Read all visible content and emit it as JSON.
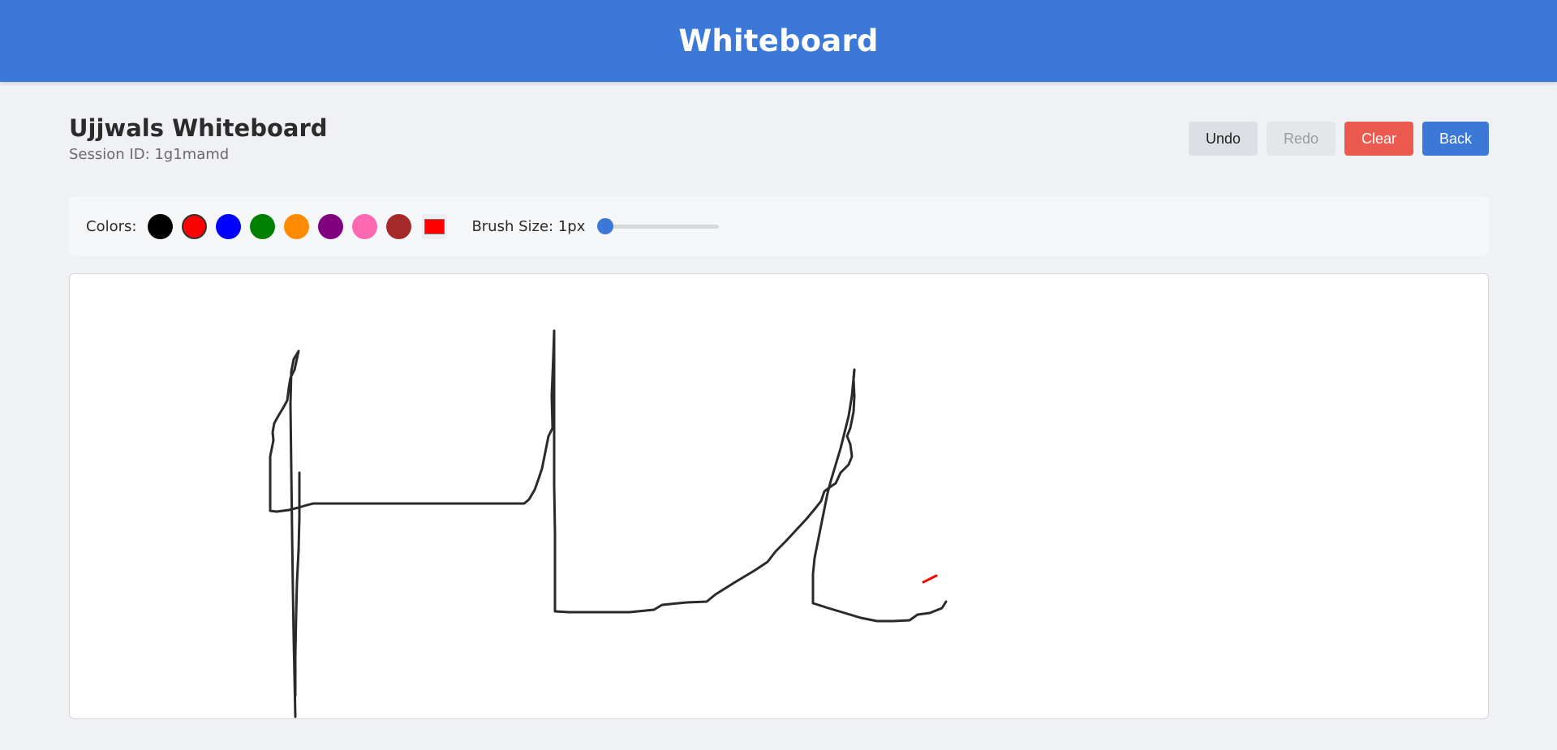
{
  "header": {
    "title": "Whiteboard"
  },
  "board": {
    "name": "Ujjwals Whiteboard",
    "session_text": "Session ID: 1g1mamd"
  },
  "actions": {
    "undo_label": "Undo",
    "redo_label": "Redo",
    "clear_label": "Clear",
    "back_label": "Back"
  },
  "toolbar": {
    "colors_label": "Colors:",
    "palette": [
      {
        "name": "black",
        "hex": "#000000"
      },
      {
        "name": "red",
        "hex": "#ff0000"
      },
      {
        "name": "blue",
        "hex": "#0000ff"
      },
      {
        "name": "green",
        "hex": "#008000"
      },
      {
        "name": "orange",
        "hex": "#ff8c00"
      },
      {
        "name": "purple",
        "hex": "#800080"
      },
      {
        "name": "pink",
        "hex": "#ff69b4"
      },
      {
        "name": "brown",
        "hex": "#a52a2a"
      }
    ],
    "selected_color": "#ff0000",
    "brush_label": "Brush Size: 1px",
    "brush_size": 1,
    "brush_slider_fraction": 0
  },
  "colors": {
    "header": "#3b78d8",
    "ink": "#2a2a2a",
    "accent_stroke": "#ff0000",
    "clear_button": "#ec5a4f"
  }
}
